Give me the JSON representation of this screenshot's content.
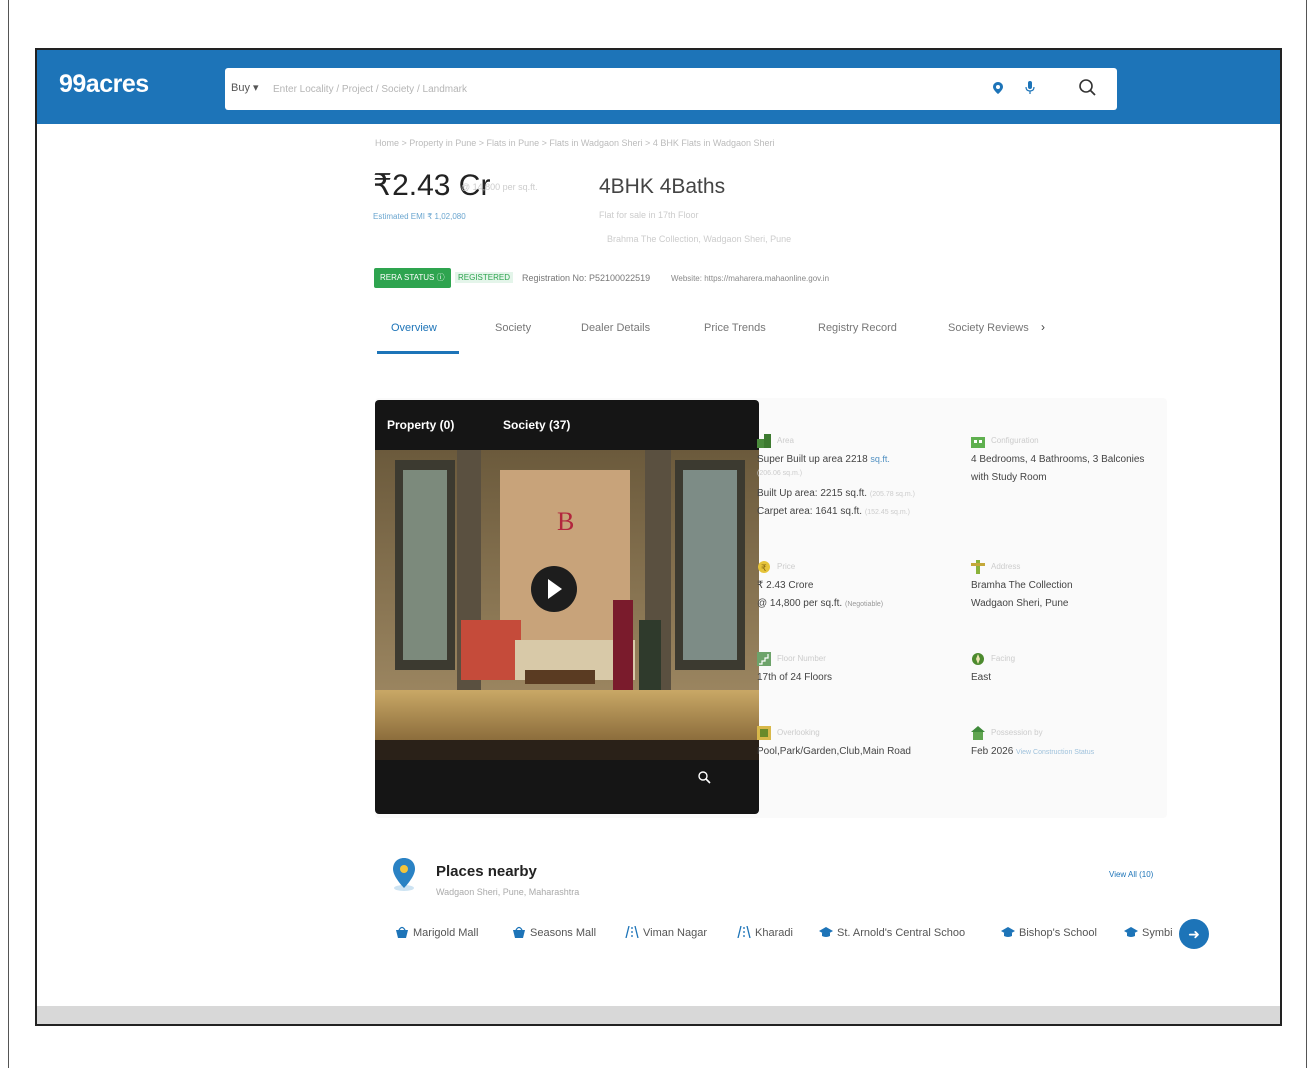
{
  "app": {
    "logo": "99acres"
  },
  "search": {
    "buy_label": "Buy",
    "placeholder": "Enter Locality / Project / Society / Landmark"
  },
  "breadcrumb": "Home > Property in Pune > Flats in Pune > Flats in Wadgaon Sheri > 4 BHK Flats in Wadgaon Sheri",
  "header": {
    "price": "₹2.43 Cr",
    "price_sub": "@ 14,800 per sq.ft.",
    "emi": "Estimated EMI ₹ 1,02,080",
    "bhk": "4BHK 4Baths",
    "bhk_sub1": "Flat for sale in 17th Floor",
    "bhk_sub2": "Brahma The Collection, Wadgaon Sheri, Pune"
  },
  "rera": {
    "status": "RERA STATUS",
    "registered": "REGISTERED",
    "reg_no": "Registration No: P52100022519",
    "website": "Website: https://maharera.mahaonline.gov.in"
  },
  "tabs": [
    "Overview",
    "Society",
    "Dealer Details",
    "Price Trends",
    "Registry Record",
    "Society Reviews"
  ],
  "tabs_next": "›",
  "media": {
    "property_tab": "Property (0)",
    "society_tab": "Society (37)"
  },
  "details": {
    "area": {
      "label": "Area",
      "super": "Super Built up area 2218",
      "super_unit": "sq.ft.",
      "super_sub": "(206.06 sq.m.)",
      "built": "Built Up area: 2215 sq.ft.",
      "built_sub": "(205.78 sq.m.)",
      "carpet": "Carpet area: 1641 sq.ft.",
      "carpet_sub": "(152.45 sq.m.)"
    },
    "config": {
      "label": "Configuration",
      "line1": "4 Bedrooms, 4 Bathrooms, 3 Balconies",
      "line2": "with Study Room"
    },
    "price": {
      "label": "Price",
      "line1": "₹ 2.43 Crore",
      "line2": "@ 14,800 per sq.ft.",
      "line2_sub": "(Negotiable)"
    },
    "address": {
      "label": "Address",
      "line1": "Bramha The Collection",
      "line2": "Wadgaon Sheri, Pune"
    },
    "floor": {
      "label": "Floor Number",
      "line1": "17th of 24 Floors"
    },
    "facing": {
      "label": "Facing",
      "line1": "East"
    },
    "overlooking": {
      "label": "Overlooking",
      "line1": "Pool,Park/Garden,Club,Main Road"
    },
    "possession": {
      "label": "Possession by",
      "line1": "Feb 2026",
      "line1_sub": "View Construction Status"
    }
  },
  "places": {
    "title": "Places nearby",
    "sub": "Wadgaon Sheri, Pune, Maharashtra",
    "view_all": "View All (10)",
    "chips": [
      "Marigold Mall",
      "Seasons Mall",
      "Viman Nagar",
      "Kharadi",
      "St. Arnold's Central Schoo",
      "Bishop's School",
      "Symbi"
    ],
    "chip_icons": [
      "mall-icon",
      "mall-icon",
      "road-icon",
      "road-icon",
      "school-icon",
      "school-icon",
      "school-icon"
    ]
  },
  "colors": {
    "brand": "#1d74b8",
    "rera_green": "#2ea44f"
  }
}
